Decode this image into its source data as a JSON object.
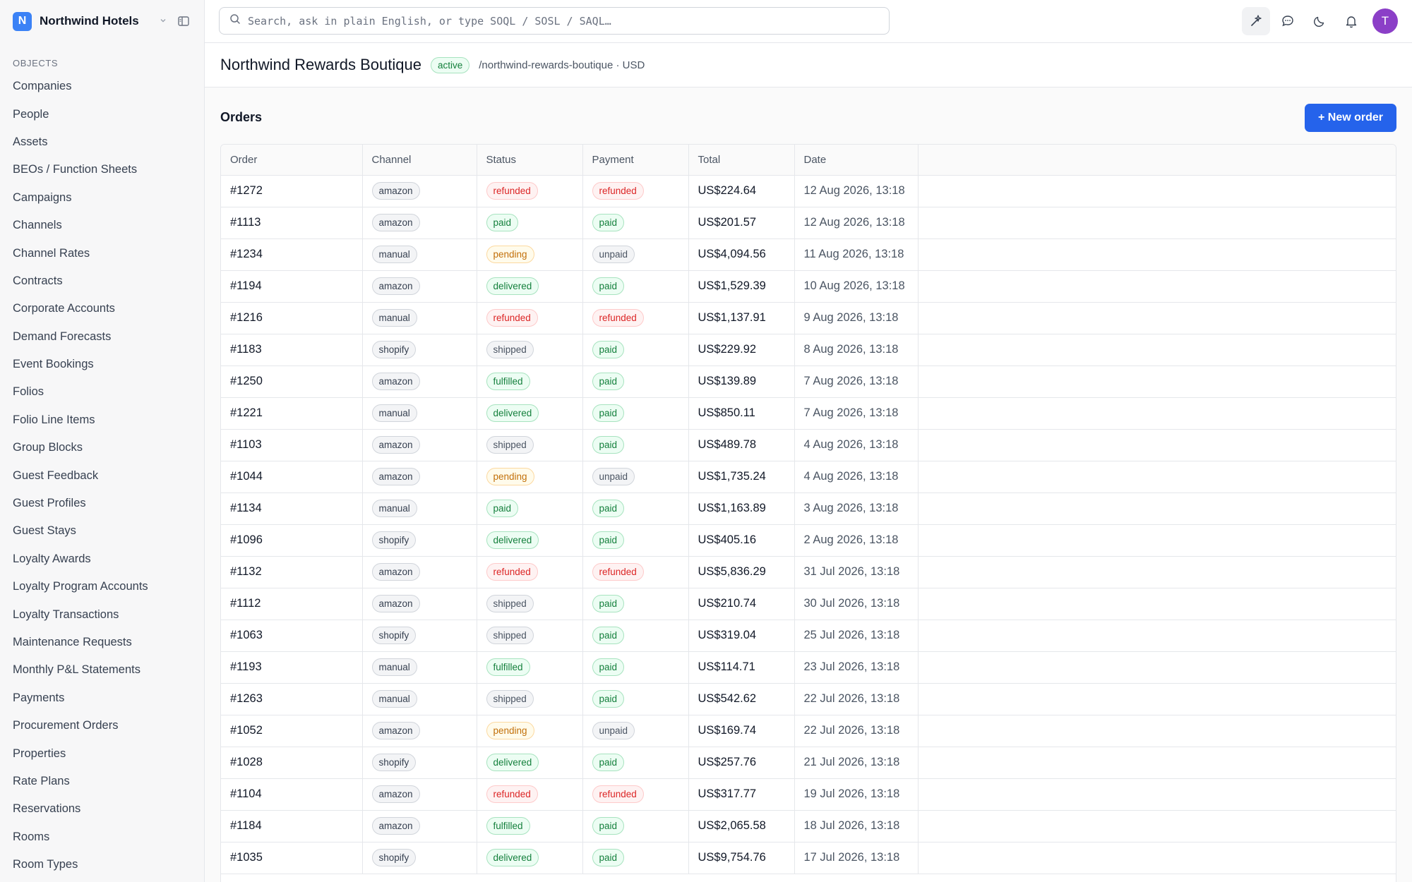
{
  "brand": {
    "initial": "N",
    "name": "Northwind Hotels"
  },
  "sidebar": {
    "section_label": "OBJECTS",
    "items": [
      "Companies",
      "People",
      "Assets",
      "BEOs / Function Sheets",
      "Campaigns",
      "Channels",
      "Channel Rates",
      "Contracts",
      "Corporate Accounts",
      "Demand Forecasts",
      "Event Bookings",
      "Folios",
      "Folio Line Items",
      "Group Blocks",
      "Guest Feedback",
      "Guest Profiles",
      "Guest Stays",
      "Loyalty Awards",
      "Loyalty Program Accounts",
      "Loyalty Transactions",
      "Maintenance Requests",
      "Monthly P&L Statements",
      "Payments",
      "Procurement Orders",
      "Properties",
      "Rate Plans",
      "Reservations",
      "Rooms",
      "Room Types"
    ]
  },
  "search": {
    "placeholder": "Search, ask in plain English, or type SOQL / SOSL / SAQL…"
  },
  "user": {
    "avatar_initial": "T"
  },
  "header": {
    "title": "Northwind Rewards Boutique",
    "status": "active",
    "slug": "/northwind-rewards-boutique · USD"
  },
  "orders": {
    "title": "Orders",
    "new_button": "+ New order",
    "columns": [
      "Order",
      "Channel",
      "Status",
      "Payment",
      "Total",
      "Date"
    ],
    "rows": [
      {
        "order": "#1272",
        "channel": "amazon",
        "status": "refunded",
        "payment": "refunded",
        "total": "US$224.64",
        "date": "12 Aug 2026, 13:18"
      },
      {
        "order": "#1113",
        "channel": "amazon",
        "status": "paid",
        "payment": "paid",
        "total": "US$201.57",
        "date": "12 Aug 2026, 13:18"
      },
      {
        "order": "#1234",
        "channel": "manual",
        "status": "pending",
        "payment": "unpaid",
        "total": "US$4,094.56",
        "date": "11 Aug 2026, 13:18"
      },
      {
        "order": "#1194",
        "channel": "amazon",
        "status": "delivered",
        "payment": "paid",
        "total": "US$1,529.39",
        "date": "10 Aug 2026, 13:18"
      },
      {
        "order": "#1216",
        "channel": "manual",
        "status": "refunded",
        "payment": "refunded",
        "total": "US$1,137.91",
        "date": "9 Aug 2026, 13:18"
      },
      {
        "order": "#1183",
        "channel": "shopify",
        "status": "shipped",
        "payment": "paid",
        "total": "US$229.92",
        "date": "8 Aug 2026, 13:18"
      },
      {
        "order": "#1250",
        "channel": "amazon",
        "status": "fulfilled",
        "payment": "paid",
        "total": "US$139.89",
        "date": "7 Aug 2026, 13:18"
      },
      {
        "order": "#1221",
        "channel": "manual",
        "status": "delivered",
        "payment": "paid",
        "total": "US$850.11",
        "date": "7 Aug 2026, 13:18"
      },
      {
        "order": "#1103",
        "channel": "amazon",
        "status": "shipped",
        "payment": "paid",
        "total": "US$489.78",
        "date": "4 Aug 2026, 13:18"
      },
      {
        "order": "#1044",
        "channel": "amazon",
        "status": "pending",
        "payment": "unpaid",
        "total": "US$1,735.24",
        "date": "4 Aug 2026, 13:18"
      },
      {
        "order": "#1134",
        "channel": "manual",
        "status": "paid",
        "payment": "paid",
        "total": "US$1,163.89",
        "date": "3 Aug 2026, 13:18"
      },
      {
        "order": "#1096",
        "channel": "shopify",
        "status": "delivered",
        "payment": "paid",
        "total": "US$405.16",
        "date": "2 Aug 2026, 13:18"
      },
      {
        "order": "#1132",
        "channel": "amazon",
        "status": "refunded",
        "payment": "refunded",
        "total": "US$5,836.29",
        "date": "31 Jul 2026, 13:18"
      },
      {
        "order": "#1112",
        "channel": "amazon",
        "status": "shipped",
        "payment": "paid",
        "total": "US$210.74",
        "date": "30 Jul 2026, 13:18"
      },
      {
        "order": "#1063",
        "channel": "shopify",
        "status": "shipped",
        "payment": "paid",
        "total": "US$319.04",
        "date": "25 Jul 2026, 13:18"
      },
      {
        "order": "#1193",
        "channel": "manual",
        "status": "fulfilled",
        "payment": "paid",
        "total": "US$114.71",
        "date": "23 Jul 2026, 13:18"
      },
      {
        "order": "#1263",
        "channel": "manual",
        "status": "shipped",
        "payment": "paid",
        "total": "US$542.62",
        "date": "22 Jul 2026, 13:18"
      },
      {
        "order": "#1052",
        "channel": "amazon",
        "status": "pending",
        "payment": "unpaid",
        "total": "US$169.74",
        "date": "22 Jul 2026, 13:18"
      },
      {
        "order": "#1028",
        "channel": "shopify",
        "status": "delivered",
        "payment": "paid",
        "total": "US$257.76",
        "date": "21 Jul 2026, 13:18"
      },
      {
        "order": "#1104",
        "channel": "amazon",
        "status": "refunded",
        "payment": "refunded",
        "total": "US$317.77",
        "date": "19 Jul 2026, 13:18"
      },
      {
        "order": "#1184",
        "channel": "amazon",
        "status": "fulfilled",
        "payment": "paid",
        "total": "US$2,065.58",
        "date": "18 Jul 2026, 13:18"
      },
      {
        "order": "#1035",
        "channel": "shopify",
        "status": "delivered",
        "payment": "paid",
        "total": "US$9,754.76",
        "date": "17 Jul 2026, 13:18"
      }
    ]
  },
  "colors": {
    "accent": "#2563eb",
    "brand": "#3b82f6",
    "avatar": "#8b3fc7",
    "danger": "#dc2626",
    "success": "#15803d",
    "warning": "#c2700a"
  }
}
